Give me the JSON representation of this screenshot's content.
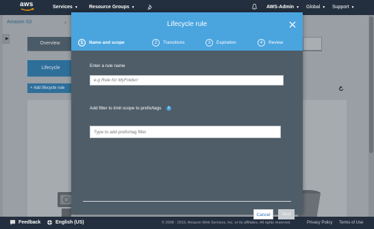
{
  "nav": {
    "logo": "aws",
    "services": "Services",
    "resource_groups": "Resource Groups",
    "account": "AWS-Admin",
    "region": "Global",
    "support": "Support",
    "pin_icon": "pin-icon",
    "bell_icon": "bell-icon"
  },
  "page": {
    "breadcrumb": "Amazon S3",
    "breadcrumb_sep": "›",
    "tab_overview": "Overview",
    "lifecycle_button": "Lifecycle",
    "add_rule_button": "+ Add lifecycle rule"
  },
  "modal": {
    "title": "Lifecycle rule",
    "steps": [
      {
        "num": "1",
        "label": "Name and scope"
      },
      {
        "num": "2",
        "label": "Transitions"
      },
      {
        "num": "3",
        "label": "Expiration"
      },
      {
        "num": "4",
        "label": "Review"
      }
    ],
    "active_step": 1,
    "rule_name_label": "Enter a rule name",
    "rule_name_placeholder": "e.g Rule for MyFolder/",
    "rule_name_value": "",
    "filter_label": "Add filter to limit scope to prefix/tags",
    "filter_placeholder": "Type to add prefix/tag filter",
    "filter_value": "",
    "cancel": "Cancel",
    "next": "Next"
  },
  "footer": {
    "feedback": "Feedback",
    "language": "English (US)",
    "copyright": "© 2008 - 2019, Amazon Web Services, Inc. or its affiliates. All rights reserved.",
    "privacy": "Privacy Policy",
    "terms": "Terms of Use"
  },
  "colors": {
    "nav_bg": "#232f3e",
    "modal_header": "#4aa4de",
    "modal_body": "#4f5d68",
    "link_blue": "#2b72b8"
  }
}
